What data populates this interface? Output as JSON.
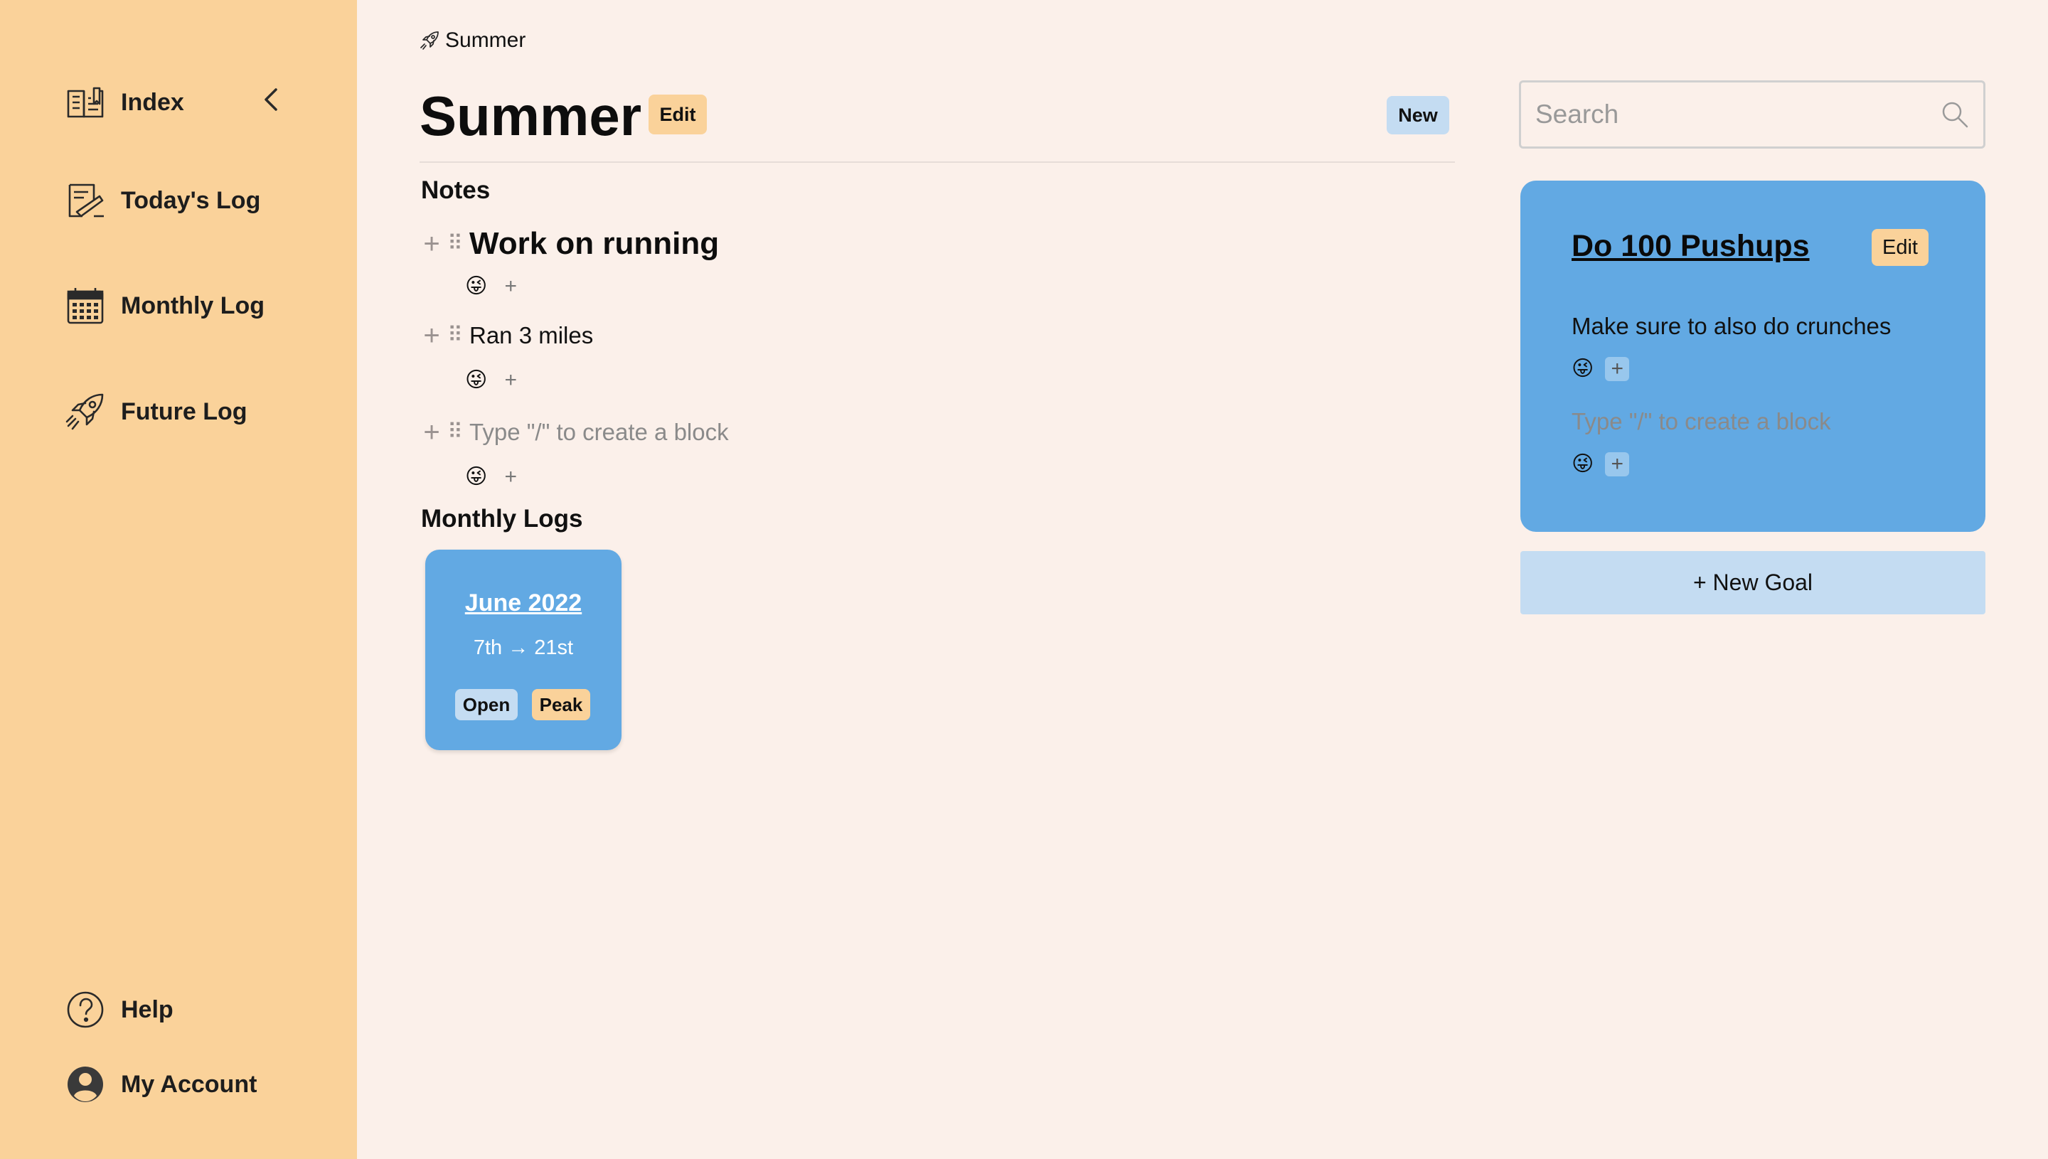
{
  "sidebar": {
    "items": [
      {
        "label": "Index",
        "icon": "book-icon"
      },
      {
        "label": "Today's Log",
        "icon": "pen-paper-icon"
      },
      {
        "label": "Monthly Log",
        "icon": "calendar-icon"
      },
      {
        "label": "Future Log",
        "icon": "rocket-icon"
      }
    ],
    "bottom": [
      {
        "label": "Help",
        "icon": "help-icon"
      },
      {
        "label": "My Account",
        "icon": "account-icon"
      }
    ],
    "colors": {
      "background": "#fad29a"
    }
  },
  "breadcrumb": {
    "label": "Summer",
    "icon": "rocket-icon"
  },
  "page": {
    "title": "Summer",
    "edit_label": "Edit",
    "new_label": "New"
  },
  "notes": {
    "heading": "Notes",
    "blocks": [
      {
        "text": "Work on running",
        "reaction": "😜",
        "add": "+"
      },
      {
        "text": "Ran 3 miles",
        "reaction": "😜",
        "add": "+"
      },
      {
        "placeholder": "Type \"/\" to create a block",
        "reaction": "😜",
        "add": "+"
      }
    ]
  },
  "monthly_logs": {
    "heading": "Monthly Logs",
    "cards": [
      {
        "title": "June 2022",
        "range": "7th → 21st",
        "open_label": "Open",
        "peak_label": "Peak"
      }
    ]
  },
  "search": {
    "placeholder": "Search"
  },
  "goal": {
    "title": "Do 100 Pushups",
    "edit_label": "Edit",
    "description": "Make sure to also do crunches",
    "placeholder": "Type \"/\" to create a block",
    "reaction": "😜",
    "add": "+"
  },
  "new_goal_label": "+ New Goal",
  "colors": {
    "accent_blue": "#62a9e3",
    "light_blue": "#c4dcf2",
    "peach": "#fad29a",
    "background": "#fbf0ea"
  }
}
